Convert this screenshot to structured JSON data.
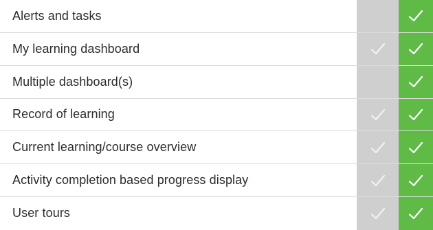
{
  "rows": [
    {
      "label": "Alerts and tasks",
      "col_a_check": false,
      "col_b_check": true
    },
    {
      "label": "My learning dashboard",
      "col_a_check": true,
      "col_b_check": true
    },
    {
      "label": "Multiple dashboard(s)",
      "col_a_check": false,
      "col_b_check": true
    },
    {
      "label": "Record of learning",
      "col_a_check": true,
      "col_b_check": true
    },
    {
      "label": "Current learning/course overview",
      "col_a_check": true,
      "col_b_check": true
    },
    {
      "label": "Activity completion based progress display",
      "col_a_check": true,
      "col_b_check": true
    },
    {
      "label": "User tours",
      "col_a_check": true,
      "col_b_check": true
    }
  ],
  "icons": {
    "check": "checkmark-icon"
  },
  "colors": {
    "col_a_bg": "#cfcfcf",
    "col_b_bg": "#5fba46",
    "text": "#2b2b2b"
  }
}
